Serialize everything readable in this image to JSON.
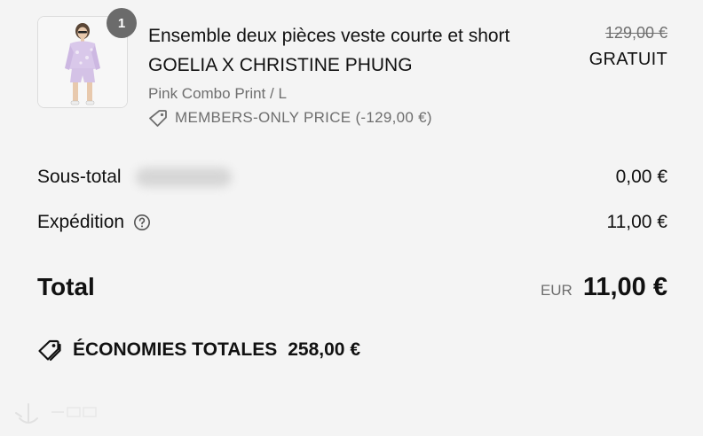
{
  "line_item": {
    "quantity": "1",
    "name_line_1": "Ensemble deux pièces veste courte et short",
    "name_line_2": "GOELIA X CHRISTINE PHUNG",
    "variant": "Pink Combo Print / L",
    "discount_label": "MEMBERS-ONLY PRICE (-129,00 €)",
    "original_price": "129,00 €",
    "final_price": "GRATUIT",
    "image_icon": "product-photo-icon"
  },
  "summary": {
    "subtotal_label": "Sous-total",
    "subtotal_value": "0,00 €",
    "shipping_label": "Expédition",
    "shipping_value": "11,00 €",
    "shipping_help_icon": "question-circle-icon",
    "total_label": "Total",
    "currency_code": "EUR",
    "total_value": "11,00 €"
  },
  "savings": {
    "icon": "tags-icon",
    "label": "ÉCONOMIES TOTALES",
    "value": "258,00 €"
  },
  "colors": {
    "background": "#f4f4f4",
    "text_primary": "#111111",
    "text_secondary": "#6e6e6e",
    "badge_background": "#6b6b6b"
  }
}
